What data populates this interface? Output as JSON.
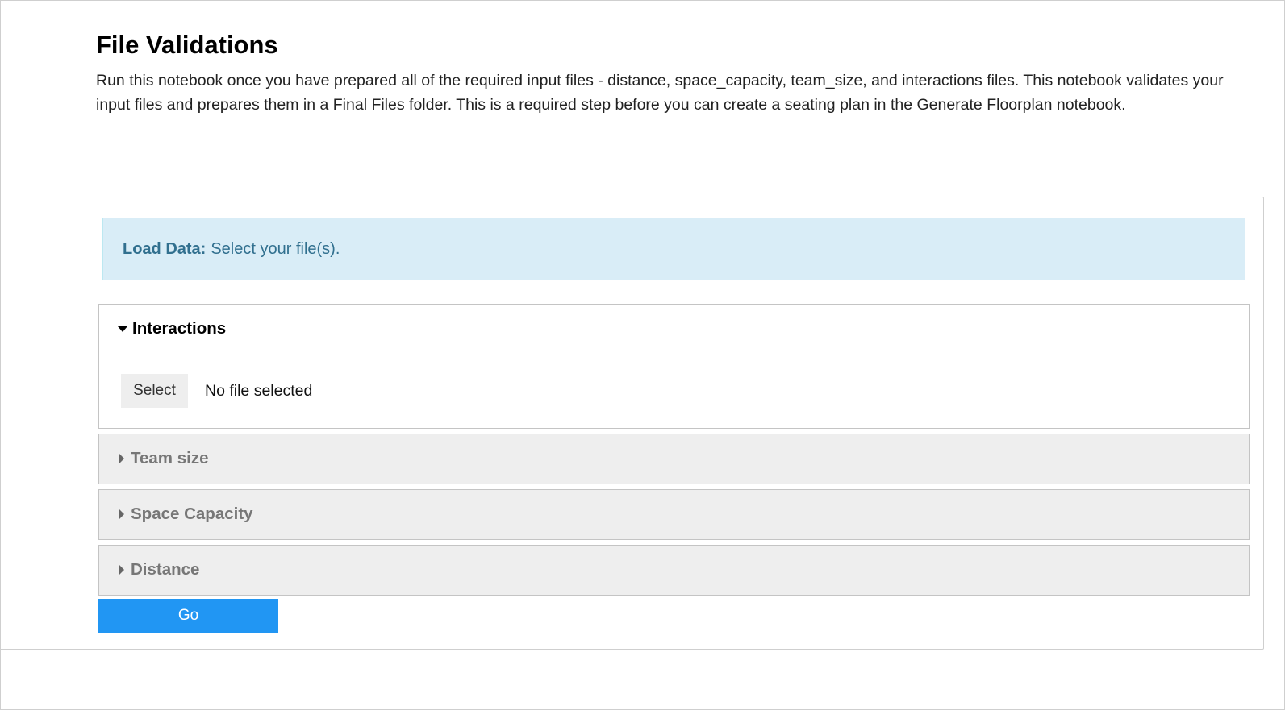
{
  "header": {
    "title": "File Validations",
    "description": "Run this notebook once you have prepared all of the required input files - distance, space_capacity, team_size, and interactions files. This notebook validates your input files and prepares them in a Final Files folder. This is a required step before you can create a seating plan in the Generate Floorplan notebook."
  },
  "alert": {
    "label": "Load Data:",
    "message": "Select your file(s)."
  },
  "accordions": [
    {
      "title": "Interactions",
      "expanded": true,
      "select_label": "Select",
      "file_status": "No file selected"
    },
    {
      "title": "Team size",
      "expanded": false
    },
    {
      "title": "Space Capacity",
      "expanded": false
    },
    {
      "title": "Distance",
      "expanded": false
    }
  ],
  "go_button": {
    "label": "Go"
  },
  "colors": {
    "alert_bg": "#d9edf7",
    "alert_text": "#31708f",
    "primary_button": "#2196f3",
    "collapsed_panel_bg": "#eeeeee"
  }
}
